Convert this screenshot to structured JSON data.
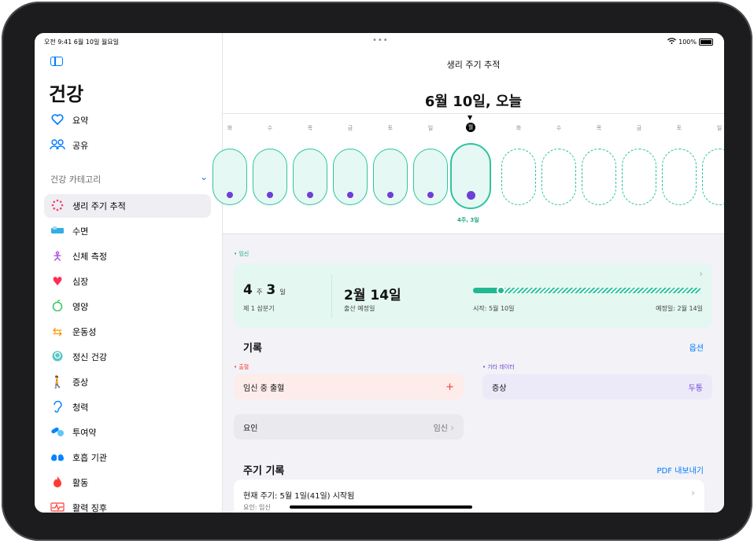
{
  "status": {
    "time_date": "오전 9:41  6월 10일 월요일",
    "battery": "100%"
  },
  "sidebar": {
    "title": "건강",
    "top_items": [
      {
        "label": "요약",
        "icon": "heart-outline-icon"
      },
      {
        "label": "공유",
        "icon": "people-icon"
      }
    ],
    "category_header": "건강 카테고리",
    "items": [
      {
        "label": "생리 주기 추적",
        "icon": "cycle-tracking-icon",
        "selected": true
      },
      {
        "label": "수면",
        "icon": "bed-icon"
      },
      {
        "label": "신체 측정",
        "icon": "body-figure-icon"
      },
      {
        "label": "심장",
        "icon": "heart-icon"
      },
      {
        "label": "영양",
        "icon": "apple-icon"
      },
      {
        "label": "운동성",
        "icon": "arrows-icon"
      },
      {
        "label": "정신 건강",
        "icon": "brain-icon"
      },
      {
        "label": "증상",
        "icon": "person-symptom-icon"
      },
      {
        "label": "청력",
        "icon": "ear-icon"
      },
      {
        "label": "투여약",
        "icon": "pills-icon"
      },
      {
        "label": "호흡 기관",
        "icon": "lungs-icon"
      },
      {
        "label": "활동",
        "icon": "flame-icon"
      },
      {
        "label": "활력 징후",
        "icon": "vitals-icon"
      }
    ]
  },
  "main": {
    "nav_title": "생리 주기 추적",
    "date_title": "6월 10일, 오늘",
    "days": [
      "화",
      "수",
      "목",
      "금",
      "토",
      "일",
      "월",
      "화",
      "수",
      "목",
      "금",
      "토",
      "일"
    ],
    "today_index": 6,
    "week_label": "4주, 3일",
    "pregnancy": {
      "tag": "• 임신",
      "weeks": "4",
      "weeks_unit": "주",
      "days": "3",
      "days_unit": "일",
      "trimester": "제 1 삼분기",
      "due_date": "2월 14일",
      "due_label": "출산 예정일",
      "start_label": "시작: 5월 10일",
      "end_label": "예정일: 2월 14일",
      "progress": 0.12
    },
    "records": {
      "title": "기록",
      "options": "옵션",
      "bleeding_tag": "• 출혈",
      "other_tag": "• 기타 데이터",
      "bleeding_label": "임신 중 출혈",
      "bleeding_action": "+",
      "symptom_label": "증상",
      "symptom_value": "두통",
      "factor_label": "요인",
      "factor_value": "임신"
    },
    "cycle": {
      "title": "주기 기록",
      "export": "PDF 내보내기",
      "current": "현재 주기: 5월 1일(41일) 시작됨",
      "factor": "요인: 임신"
    }
  },
  "colors": {
    "accent": "#007aff",
    "teal": "#2ec4a0",
    "purple": "#6e3fd6",
    "red": "#ff3b30"
  }
}
